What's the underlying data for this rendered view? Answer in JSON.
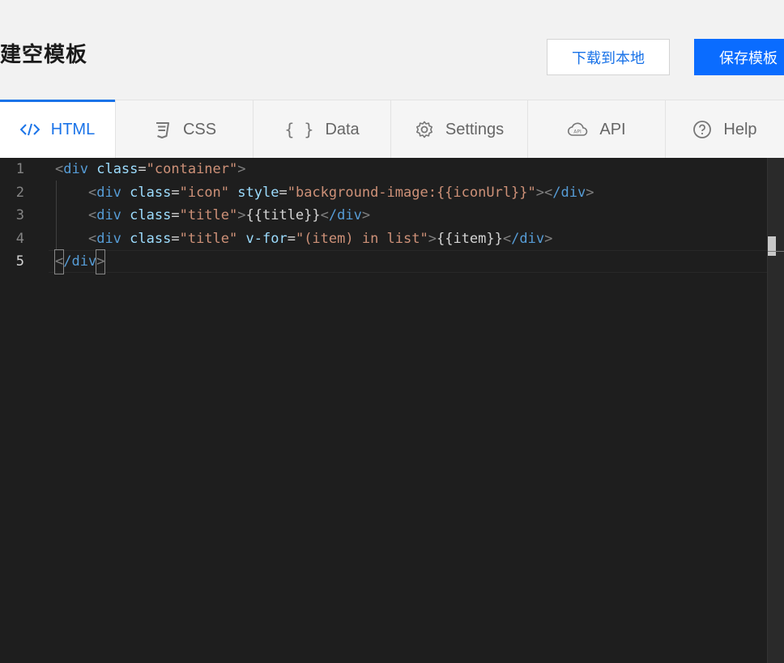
{
  "header": {
    "title": "建空模板",
    "download_label": "下载到本地",
    "save_label": "保存模板"
  },
  "tabs": [
    {
      "label": "HTML",
      "icon": "code-icon",
      "active": true
    },
    {
      "label": "CSS",
      "icon": "css3-icon",
      "active": false
    },
    {
      "label": "Data",
      "icon": "braces-icon",
      "active": false
    },
    {
      "label": "Settings",
      "icon": "gear-icon",
      "active": false
    },
    {
      "label": "API",
      "icon": "api-cloud-icon",
      "active": false
    },
    {
      "label": "Help",
      "icon": "help-circle-icon",
      "active": false
    }
  ],
  "editor": {
    "line_numbers": [
      "1",
      "2",
      "3",
      "4",
      "5"
    ],
    "active_line": "5",
    "lines": [
      "<div class=\"container\">",
      "    <div class=\"icon\" style=\"background-image:{{iconUrl}}\"></div>",
      "    <div class=\"title\">{{title}}</div>",
      "    <div class=\"title\" v-for=\"(item) in list\">{{item}}</div>",
      "</div>"
    ]
  },
  "colors": {
    "accent": "#1a73e8",
    "save_button": "#0a6cff",
    "editor_bg": "#1e1e1e",
    "tag": "#569cd6",
    "attribute": "#9cdcfe",
    "string": "#ce9178"
  }
}
